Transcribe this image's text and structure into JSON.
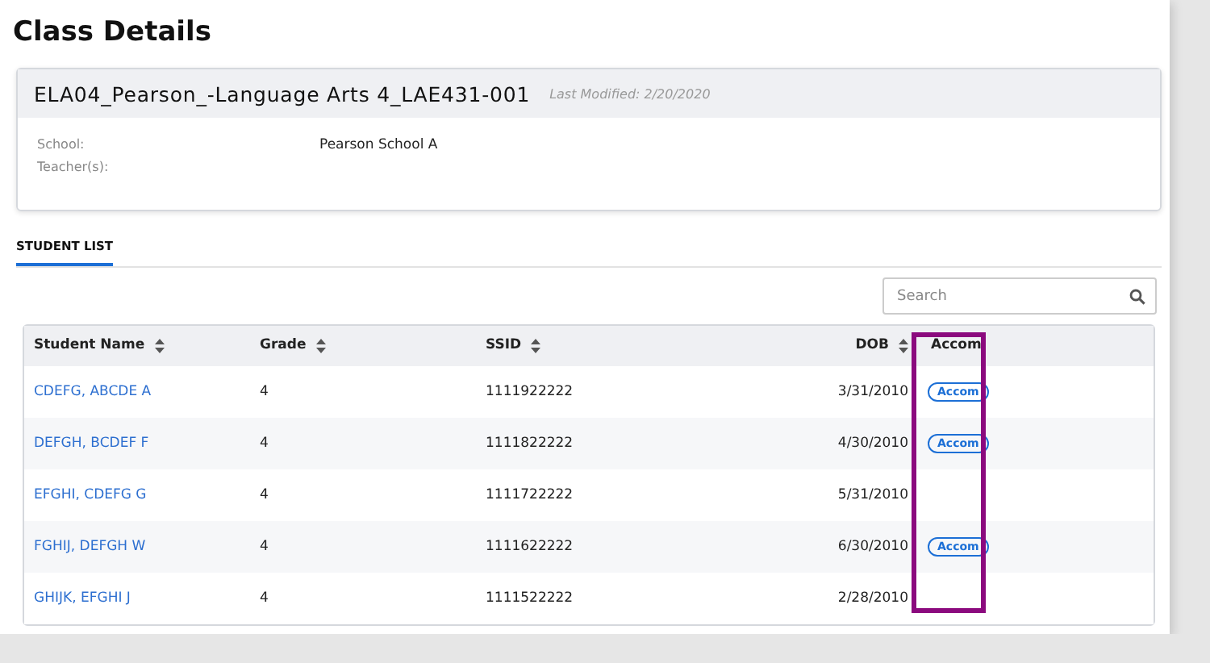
{
  "title": "Class Details",
  "class_card": {
    "name": "ELA04_Pearson_-Language Arts 4_LAE431-001",
    "last_modified": "Last Modified: 2/20/2020",
    "fields": [
      {
        "label": "School:",
        "value": "Pearson School A"
      },
      {
        "label": "Teacher(s):"
      }
    ]
  },
  "tabs": [
    {
      "label": "STUDENT LIST",
      "selected": true
    }
  ],
  "search": {
    "placeholder": "Search"
  },
  "table": {
    "columns": [
      {
        "label": "Student Name",
        "sortable": true,
        "highlighted": false
      },
      {
        "label": "Grade",
        "sortable": true,
        "highlighted": false
      },
      {
        "label": "SSID",
        "sortable": true,
        "highlighted": false
      },
      {
        "label": "DOB",
        "sortable": true,
        "highlighted": false
      },
      {
        "label": "Accom",
        "sortable": false,
        "highlighted": true
      }
    ],
    "rows": [
      {
        "name": "CDEFG, ABCDE A",
        "grade": "4",
        "ssid": "1111922222",
        "dob": "3/31/2010",
        "accom": "Accom"
      },
      {
        "name": "DEFGH, BCDEF F",
        "grade": "4",
        "ssid": "1111822222",
        "dob": "4/30/2010",
        "accom": "Accom"
      },
      {
        "name": "EFGHI, CDEFG G",
        "grade": "4",
        "ssid": "1111722222",
        "dob": "5/31/2010"
      },
      {
        "name": "FGHIJ, DEFGH W",
        "grade": "4",
        "ssid": "1111622222",
        "dob": "6/30/2010",
        "accom": "Accom"
      },
      {
        "name": "GHIJK, EFGHI J",
        "grade": "4",
        "ssid": "1111522222",
        "dob": "2/28/2010"
      }
    ]
  }
}
